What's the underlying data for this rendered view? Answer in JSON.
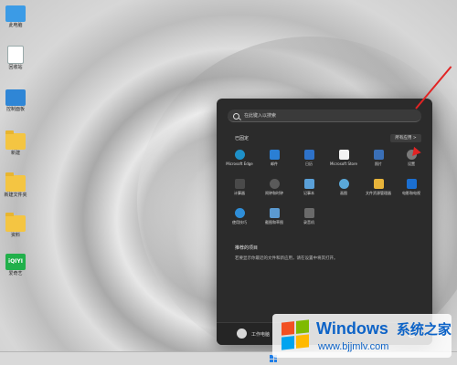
{
  "desktop": {
    "icons": [
      {
        "label": "此电脑",
        "icon": "computer-icon"
      },
      {
        "label": "回收站",
        "icon": "recycle-bin-icon"
      },
      {
        "label": "控制面板",
        "icon": "control-panel-icon"
      },
      {
        "label": "新建",
        "icon": "folder-icon"
      },
      {
        "label": "新建文件夹",
        "icon": "folder-icon"
      },
      {
        "label": "资料",
        "icon": "folder-icon"
      },
      {
        "label": "爱奇艺",
        "icon": "iqiyi-icon"
      }
    ]
  },
  "start_menu": {
    "search_placeholder": "在此键入以搜索",
    "pinned_title": "已固定",
    "all_apps_label": "所有应用 >",
    "apps": [
      {
        "label": "Microsoft Edge",
        "color": "#1e90c8"
      },
      {
        "label": "邮件",
        "color": "#2a7fd4"
      },
      {
        "label": "日历",
        "color": "#2e72c9"
      },
      {
        "label": "Microsoft Store",
        "color": "#f2f2f2"
      },
      {
        "label": "照片",
        "color": "#3a6fb6"
      },
      {
        "label": "设置",
        "color": "#7a7a7a"
      },
      {
        "label": "计算器",
        "color": "#4a4a4a"
      },
      {
        "label": "闹钟和时钟",
        "color": "#5a5a5a"
      },
      {
        "label": "记事本",
        "color": "#5aa0d8"
      },
      {
        "label": "画图",
        "color": "#5aa8d8"
      },
      {
        "label": "文件资源管理器",
        "color": "#e8b43a"
      },
      {
        "label": "电影和电视",
        "color": "#1b6fd1"
      },
      {
        "label": "使用技巧",
        "color": "#2f8ed8"
      },
      {
        "label": "截图和草图",
        "color": "#5b9ad1"
      },
      {
        "label": "录音机",
        "color": "#6a6a6a"
      }
    ],
    "recommended_title": "推荐的项目",
    "recommended_text": "若要显示你最近的文件和新应用，请在设置中将其打开。",
    "user_name": "工作电脑"
  },
  "watermark": {
    "title": "Windows",
    "subtitle": "系统之家",
    "url": "www.bjjmlv.com"
  }
}
